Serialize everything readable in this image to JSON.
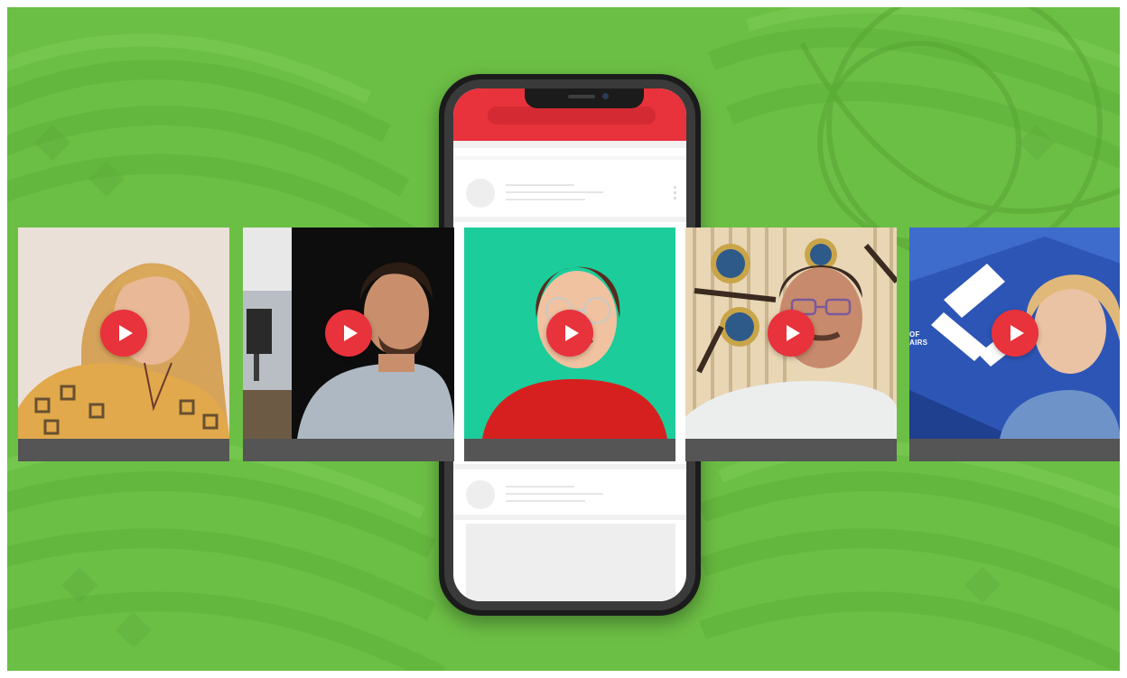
{
  "background": {
    "color": "#6cbf45",
    "accent": "#e8323c"
  },
  "phone": {
    "header_color": "#e8323c",
    "feed_items": [
      "post-placeholder",
      "video-post",
      "post-placeholder",
      "card-placeholder"
    ]
  },
  "videos": [
    {
      "name": "woman-blonde",
      "play_icon": "play-icon",
      "sign_text": ""
    },
    {
      "name": "man-dark-hair",
      "play_icon": "play-icon",
      "sign_text": ""
    },
    {
      "name": "woman-green-backdrop",
      "play_icon": "play-icon",
      "sign_text": ""
    },
    {
      "name": "man-glasses",
      "play_icon": "play-icon",
      "sign_text": ""
    },
    {
      "name": "woman-blue-backdrop",
      "play_icon": "play-icon",
      "sign_text": "OF\nAIRS"
    }
  ]
}
